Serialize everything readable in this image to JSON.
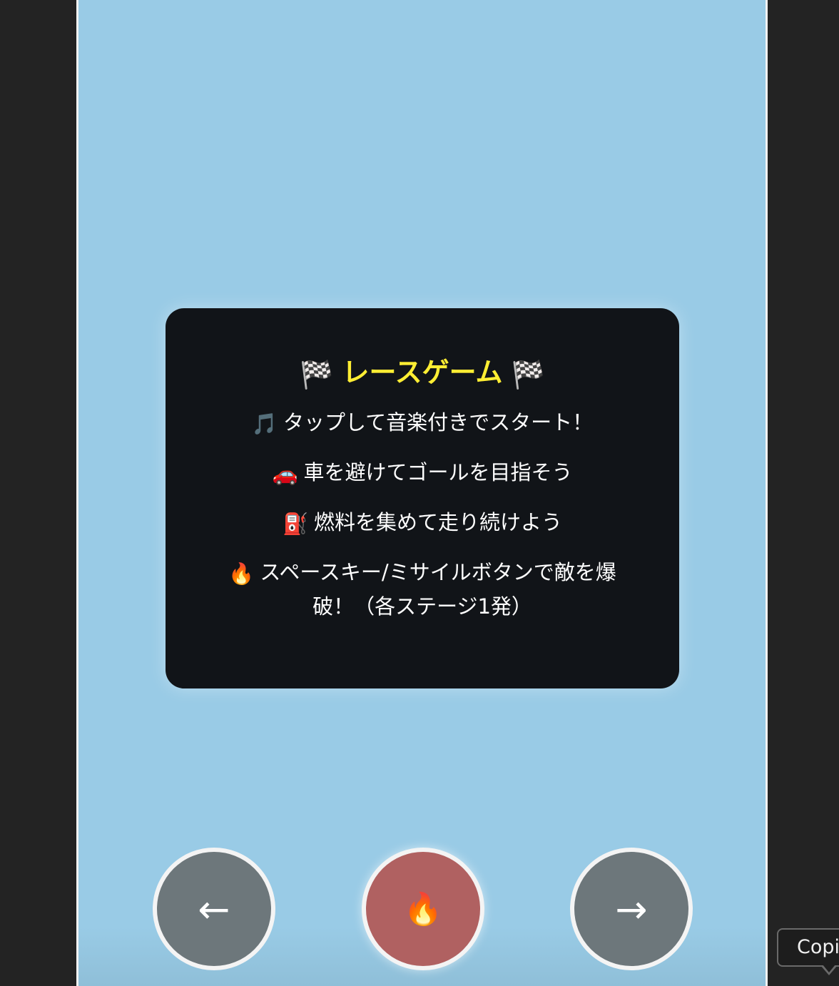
{
  "panel": {
    "flag_icon": "🏁",
    "title": "レースゲーム",
    "lines": [
      {
        "icon": "🎵",
        "text": "タップして音楽付きでスタート！"
      },
      {
        "icon": "🚗",
        "text": "車を避けてゴールを目指そう"
      },
      {
        "icon": "⛽",
        "text": "燃料を集めて走り続けよう"
      },
      {
        "icon": "🔥",
        "text": "スペースキー/ミサイルボタンで敵を爆破！（各ステージ1発）"
      }
    ]
  },
  "controls": {
    "left_label": "←",
    "fire_label": "🔥",
    "right_label": "→"
  },
  "tooltip": {
    "text": "Copi"
  },
  "colors": {
    "background": "#99cbe6",
    "panel": "#111418",
    "title": "#ffee33",
    "arrow_button": "#6d777b",
    "fire_button": "#b06161"
  }
}
